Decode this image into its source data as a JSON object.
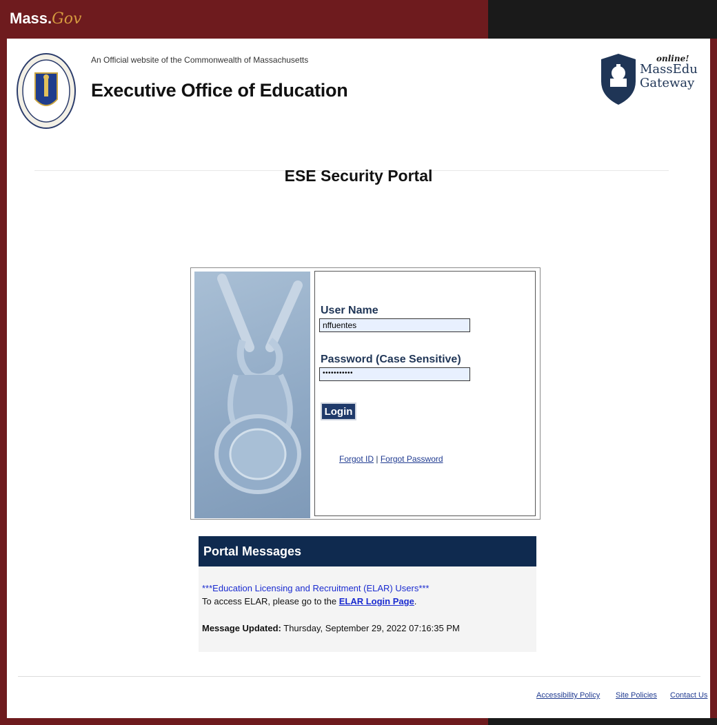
{
  "header": {
    "logo_mass": "Mass.",
    "logo_gov": "Gov",
    "official_text": "An Official website of the Commonwealth of Massachusetts",
    "agency_title": "Executive Office of Education",
    "gateway_online": "online!",
    "gateway_line1": "MassEdu",
    "gateway_line2": "Gateway"
  },
  "page_title": "ESE Security Portal",
  "login": {
    "username_label": "User Name",
    "username_value": "nffuentes",
    "password_label": "Password (Case Sensitive)",
    "password_value": "•••••••••••",
    "login_button": "Login",
    "forgot_id": "Forgot ID",
    "separator": "|",
    "forgot_password": "Forgot Password"
  },
  "portal_messages": {
    "heading": "Portal Messages",
    "line1": "***Education Licensing and Recruitment (ELAR) Users***",
    "line2_prefix": "To access ELAR, please go to the ",
    "line2_link": "ELAR Login Page",
    "line2_suffix": ".",
    "updated_label": "Message Updated:",
    "updated_value": " Thursday, September 29, 2022 07:16:35 PM"
  },
  "footer": {
    "accessibility": "Accessibility Policy",
    "site_policies": "Site Policies",
    "contact": "Contact Us"
  },
  "colors": {
    "brand_maroon": "#6e1b1e",
    "navy": "#0f2a4f",
    "link_blue": "#1a2bd0"
  }
}
